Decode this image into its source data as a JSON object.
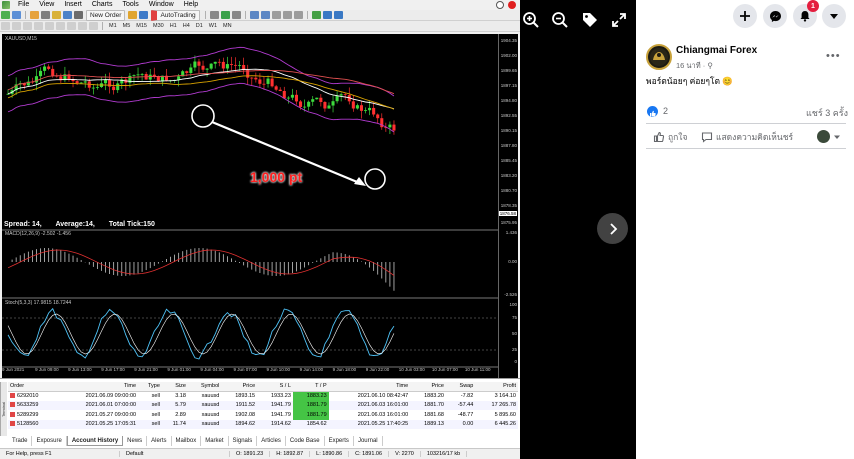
{
  "mt4": {
    "menu": [
      "File",
      "View",
      "Insert",
      "Charts",
      "Tools",
      "Window",
      "Help"
    ],
    "toolbar": {
      "new_order": "New Order",
      "autotrading": "AutoTrading",
      "timeframes": [
        "M1",
        "M5",
        "M15",
        "M30",
        "H1",
        "H4",
        "D1",
        "W1",
        "MN"
      ]
    },
    "chart": {
      "symbol_label": "XAUUSD,M15",
      "annotation": "1,000 pt",
      "spread_label": "Spread: 14,",
      "average_label": "Average:14,",
      "total_tick_label": "Total Tick:150",
      "price_ticks": [
        "1904.35",
        "1902.00",
        "1899.65",
        "1897.15",
        "1894.80",
        "1892.55",
        "1890.15",
        "1887.80",
        "1885.45",
        "1883.20",
        "1880.70",
        "1878.35",
        "1875.95"
      ],
      "current_price_label": "1876.58",
      "macd_label": "MACD(12,26,9) -2.502 -1.456",
      "macd_ticks": [
        "1.436",
        "0.00",
        "-2.526"
      ],
      "stoch_label": "Stoch(5,3,3) 17.9815 18.7244",
      "stoch_ticks": [
        "100",
        "75",
        "50",
        "25",
        "0"
      ],
      "time_labels": [
        "9 Jun 2021",
        "9 Jun 09:00",
        "9 Jun 13:00",
        "9 Jun 17:00",
        "9 Jun 21:00",
        "9 Jun 01:00",
        "9 Jun 04:00",
        "9 Jun 07:00",
        "9 Jun 10:00",
        "9 Jun 14:00",
        "9 Jun 18:00",
        "9 Jun 22:00",
        "10 Jun 03:00",
        "10 Jun 07:00",
        "10 Jun 11:00"
      ]
    },
    "terminal": {
      "side_label": "Terminal",
      "columns": [
        "Order",
        "Time",
        "Type",
        "Size",
        "Symbol",
        "Price",
        "S / L",
        "T / P",
        "Time",
        "Price",
        "Swap",
        "Profit"
      ],
      "rows": [
        [
          "6292010",
          "2021.06.09 09:00:00",
          "sell",
          "3.18",
          "xauusd",
          "1893.15",
          "1933.23",
          "1883.23",
          "2021.06.10 08:42:47",
          "1883.20",
          "-7.82",
          "3 164.10"
        ],
        [
          "5633259",
          "2021.06.01 07:00:00",
          "sell",
          "5.79",
          "xauusd",
          "1911.52",
          "1941.79",
          "1881.79",
          "2021.06.03 16:01:00",
          "1881.70",
          "-57.44",
          "17 265.78"
        ],
        [
          "5289299",
          "2021.05.27 09:00:00",
          "sell",
          "2.89",
          "xauusd",
          "1902.08",
          "1941.79",
          "1881.79",
          "2021.06.03 16:01:00",
          "1881.68",
          "-48.77",
          "5 895.60"
        ],
        [
          "5128560",
          "2021.05.25 17:05:31",
          "sell",
          "11.74",
          "xauusd",
          "1894.62",
          "1914.62",
          "1854.62",
          "2021.05.25 17:40:25",
          "1889.13",
          "0.00",
          "6 445.26"
        ]
      ],
      "tabs": [
        "Trade",
        "Exposure",
        "Account History",
        "News",
        "Alerts",
        "Mailbox",
        "Market",
        "Signals",
        "Articles",
        "Code Base",
        "Experts",
        "Journal"
      ],
      "active_tab": "Account History"
    },
    "status": {
      "help": "For Help, press F1",
      "profile": "Default",
      "open": "O: 1891.23",
      "high": "H: 1892.87",
      "low": "L: 1890.86",
      "close": "C: 1891.06",
      "volume": "V: 2270",
      "traffic": "103216/17 kb"
    }
  },
  "viewer": {
    "zoom_in": "zoom-in-icon",
    "zoom_out": "zoom-out-icon",
    "tag": "tag-icon",
    "fullscreen": "fullscreen-icon",
    "next": "chevron-right-icon"
  },
  "post": {
    "page_name": "Chiangmai Forex",
    "time": "16 นาที · ",
    "text": "พอร์ตน้อยๆ ค่อยๆโต 😊",
    "like_count": "2",
    "share_count": "แชร์ 3 ครั้ง",
    "like_label": "ถูกใจ",
    "comment_label": "แสดงความคิดเห็นชร์",
    "notification_count": "1"
  },
  "colors": {
    "facebook_blue": "#1877f2",
    "badge_red": "#e41e3f",
    "tp_green": "#45c445",
    "annotation_red": "#ff2020"
  }
}
